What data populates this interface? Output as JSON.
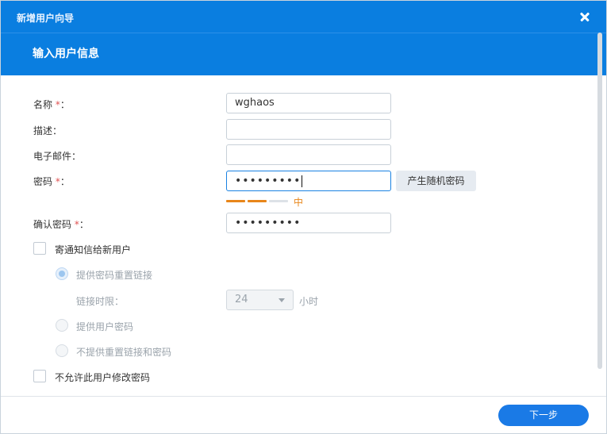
{
  "window": {
    "title": "新增用户向导"
  },
  "header": {
    "subtitle": "输入用户信息"
  },
  "form": {
    "name_label": "名称",
    "desc_label": "描述：",
    "email_label": "电子邮件：",
    "password_label": "密码",
    "confirm_label": "确认密码",
    "required_mark": "*",
    "colon": "：",
    "name_value": "wghaos",
    "desc_value": "",
    "email_value": "",
    "password_value": "•••••••••",
    "confirm_value": "•••••••••",
    "generate_button": "产生随机密码",
    "strength_text": "中",
    "strength_level": 2,
    "strength_max": 3
  },
  "notify": {
    "label": "寄通知信给新用户",
    "checked": false,
    "option_reset_link": "提供密码重置链接",
    "link_time_label": "链接时限：",
    "link_time_value": "24",
    "link_time_unit": "小时",
    "option_give_password": "提供用户密码",
    "option_none": "不提供重置链接和密码"
  },
  "disallow_change": {
    "label": "不允许此用户修改密码",
    "checked": false
  },
  "footer": {
    "next_button": "下一步"
  },
  "colors": {
    "accent": "#0a7ee0",
    "required": "#e05252",
    "strength": "#e8861a"
  }
}
